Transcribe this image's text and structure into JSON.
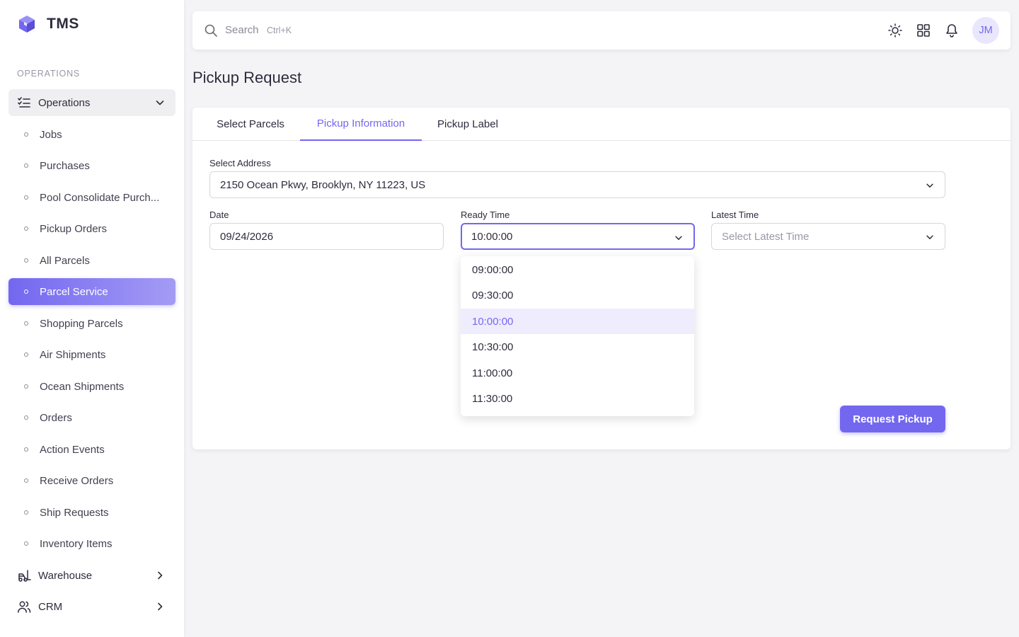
{
  "app": {
    "title": "TMS"
  },
  "colors": {
    "accent": "#7367f0",
    "accent_light": "#efedfd"
  },
  "sidebar": {
    "section_title": "OPERATIONS",
    "group": {
      "label": "Operations",
      "icon": "list-check-icon",
      "expanded": true
    },
    "items": [
      {
        "label": "Jobs"
      },
      {
        "label": "Purchases"
      },
      {
        "label": "Pool Consolidate Purch..."
      },
      {
        "label": "Pickup Orders"
      },
      {
        "label": "All Parcels"
      },
      {
        "label": "Parcel Service",
        "active": true
      },
      {
        "label": "Shopping Parcels"
      },
      {
        "label": "Air Shipments"
      },
      {
        "label": "Ocean Shipments"
      },
      {
        "label": "Orders"
      },
      {
        "label": "Action Events"
      },
      {
        "label": "Receive Orders"
      },
      {
        "label": "Ship Requests"
      },
      {
        "label": "Inventory Items"
      }
    ],
    "other_groups": [
      {
        "label": "Warehouse",
        "icon": "forklift-icon"
      },
      {
        "label": "CRM",
        "icon": "users-icon"
      }
    ]
  },
  "topbar": {
    "search_placeholder": "Search",
    "search_shortcut": "Ctrl+K",
    "avatar_initials": "JM"
  },
  "page": {
    "title": "Pickup Request"
  },
  "tabs": [
    {
      "label": "Select Parcels"
    },
    {
      "label": "Pickup Information",
      "active": true
    },
    {
      "label": "Pickup Label"
    }
  ],
  "form": {
    "address": {
      "label": "Select Address",
      "value": "2150 Ocean Pkwy, Brooklyn, NY 11223, US"
    },
    "date": {
      "label": "Date",
      "value": "09/24/2026"
    },
    "ready_time": {
      "label": "Ready Time",
      "value": "10:00:00"
    },
    "latest_time": {
      "label": "Latest Time",
      "placeholder": "Select Latest Time"
    },
    "ready_time_options": [
      "09:00:00",
      "09:30:00",
      "10:00:00",
      "10:30:00",
      "11:00:00",
      "11:30:00"
    ],
    "submit_label": "Request Pickup"
  }
}
